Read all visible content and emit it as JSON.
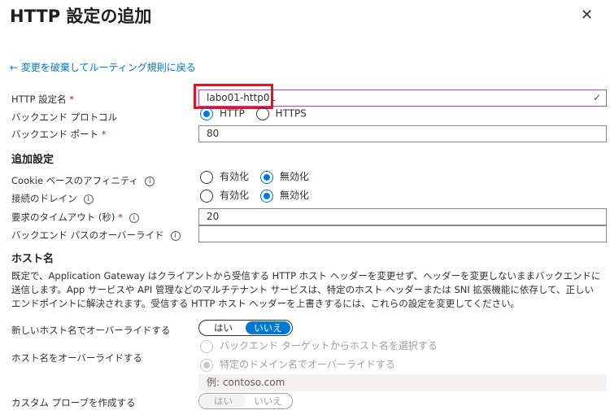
{
  "title": "HTTP 設定の追加",
  "back_link": "← 変更を破棄してルーティング規則に戻る",
  "fields": {
    "name_label": "HTTP 設定名",
    "name_value": "labo01-http01",
    "protocol_label": "バックエンド プロトコル",
    "protocol_http": "HTTP",
    "protocol_https": "HTTPS",
    "port_label": "バックエンド ポート",
    "port_value": "80"
  },
  "required_mark": "*",
  "additional": {
    "heading": "追加設定",
    "cookie_label": "Cookie ベースのアフィニティ",
    "drain_label": "接続のドレイン",
    "enable": "有効化",
    "disable": "無効化",
    "timeout_label": "要求のタイムアウト (秒)",
    "timeout_value": "20",
    "path_label": "バックエンド パスのオーバーライド",
    "path_value": ""
  },
  "host": {
    "heading": "ホスト名",
    "description": "既定で、Application Gateway はクライアントから受信する HTTP ホスト ヘッダーを変更せず、ヘッダーを変更しないままバックエンドに送信します。App サービスや API 管理などのマルチテナント サービスは、特定のホスト ヘッダーまたは SNI 拡張機能に依存して、正しいエンドポイントに解決されます。受信する HTTP ホスト ヘッダーを上書きするには、これらの設定を変更してください。",
    "override_new_label": "新しいホスト名でオーバーライドする",
    "yes": "はい",
    "no": "いいえ",
    "override_label": "ホスト名をオーバーライドする",
    "option_backend": "バックエンド ターゲットからホスト名を選択する",
    "option_domain": "特定のドメイン名でオーバーライドする",
    "domain_placeholder": "例: contoso.com",
    "probe_label": "カスタム プローブを作成する"
  }
}
